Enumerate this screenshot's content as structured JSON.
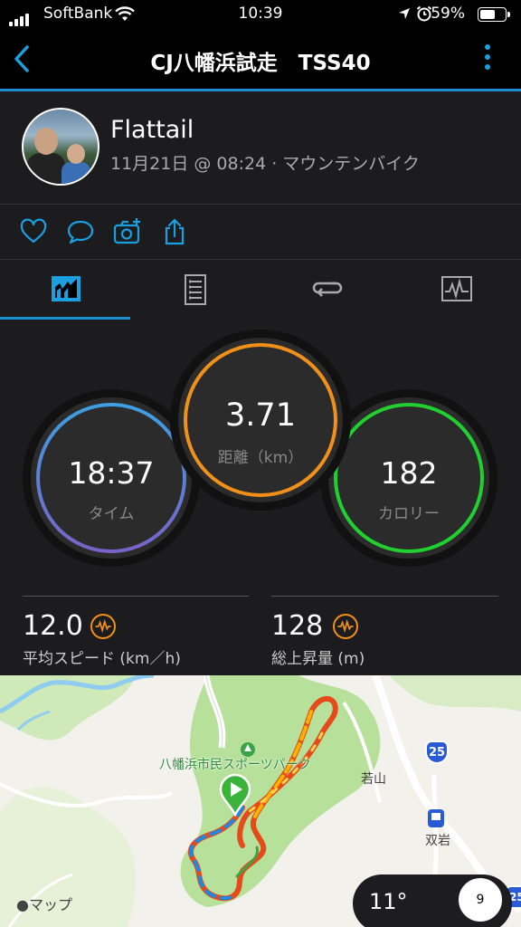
{
  "status_bar": {
    "carrier": "SoftBank",
    "time": "10:39",
    "battery_percent": "59%"
  },
  "nav": {
    "title": "CJ八幡浜試走　TSS40"
  },
  "profile": {
    "name": "Flattail",
    "meta": "11月21日 @ 08:24 · マウンテンバイク"
  },
  "actions": [
    "heart-icon",
    "comment-icon",
    "camera-icon",
    "share-icon"
  ],
  "tabs": [
    {
      "icon": "stats-tab-icon",
      "active": true
    },
    {
      "icon": "details-tab-icon",
      "active": false
    },
    {
      "icon": "laps-tab-icon",
      "active": false
    },
    {
      "icon": "chart-tab-icon",
      "active": false
    }
  ],
  "stats": {
    "time": {
      "value": "18:37",
      "label": "タイム"
    },
    "distance": {
      "value": "3.71",
      "label": "距離（km）"
    },
    "calories": {
      "value": "182",
      "label": "カロリー"
    }
  },
  "metrics": {
    "avg_speed": {
      "value": "12.0",
      "label": "平均スピード (km／h)"
    },
    "elevation_gain": {
      "value": "128",
      "label": "総上昇量 (m)"
    }
  },
  "map": {
    "park_label": "八幡浜市民スポーツパーク",
    "town_label_1": "若山",
    "town_label_2": "双岩",
    "route_number": "25",
    "route_number_2": "25",
    "attribution": "マップ",
    "temperature": "11°",
    "wind_speed": "9"
  },
  "colors": {
    "accent": "#1a8fd0",
    "distance_ring": "#f0901a",
    "calorie_ring": "#20d030"
  }
}
